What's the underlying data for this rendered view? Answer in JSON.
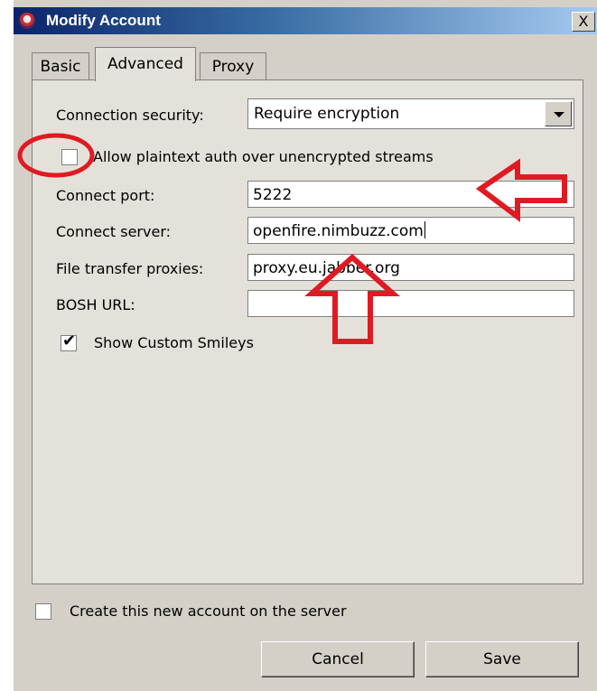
{
  "window": {
    "title": "Modify Account",
    "close_symbol": "X"
  },
  "tabs": [
    {
      "label": "Basic",
      "selected": false
    },
    {
      "label": "Advanced",
      "selected": true
    },
    {
      "label": "Proxy",
      "selected": false
    }
  ],
  "advanced": {
    "connection_security": {
      "label": "Connection security:",
      "value": "Require encryption"
    },
    "plaintext_auth": {
      "label": "Allow plaintext auth over unencrypted streams",
      "checked": false
    },
    "connect_port": {
      "label": "Connect port:",
      "value": "5222"
    },
    "connect_server": {
      "label": "Connect server:",
      "value": "openfire.nimbuzz.com"
    },
    "file_transfer_proxies": {
      "label": "File transfer proxies:",
      "value": "proxy.eu.jabber.org"
    },
    "bosh_url": {
      "label": "BOSH URL:",
      "value": ""
    },
    "show_custom_smileys": {
      "label": "Show Custom Smileys",
      "checked": true
    }
  },
  "create_on_server": {
    "label": "Create this new account on the server",
    "checked": false
  },
  "buttons": {
    "cancel": "Cancel",
    "save": "Save"
  },
  "annotation_color": "#e01a22"
}
